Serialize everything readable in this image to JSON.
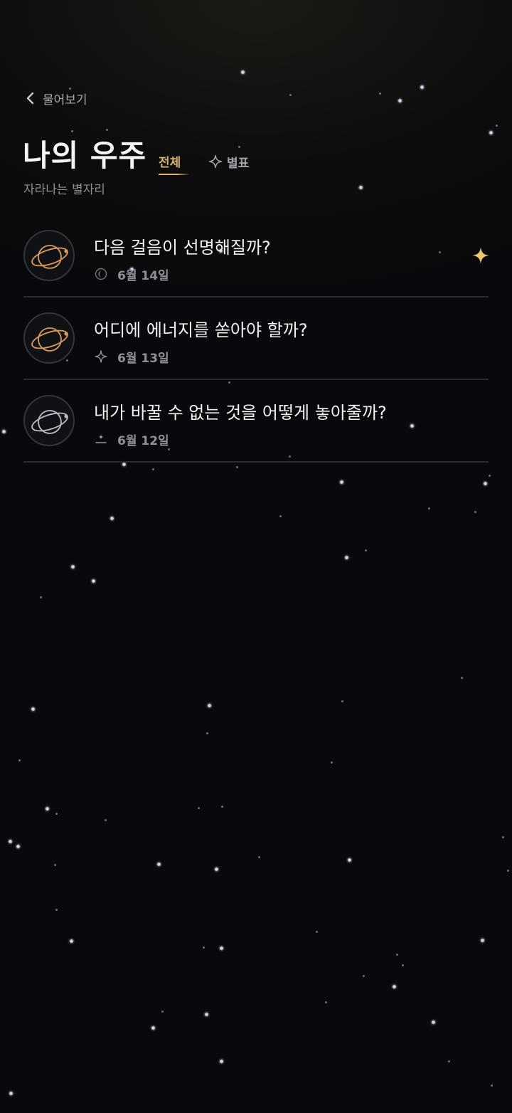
{
  "header": {
    "back_label": "물어보기",
    "title": "나의 우주",
    "subtitle": "자라나는 별자리"
  },
  "tabs": {
    "all_label": "전체",
    "starred_label": "별표",
    "active": "all"
  },
  "colors": {
    "accent": "#d8b26a",
    "orbit_gold": "#d99a5b",
    "orbit_silver": "#b9bdc7",
    "background": "#08090c"
  },
  "questions": [
    {
      "text": "다음 걸음이 선명해질까?",
      "date": "6월 14일",
      "icon": "moon-icon",
      "orbit": "gold",
      "starred": true
    },
    {
      "text": "어디에 에너지를 쏟아야 할까?",
      "date": "6월 13일",
      "icon": "sparkle-icon",
      "orbit": "gold",
      "starred": false
    },
    {
      "text": "내가 바꿀 수 없는 것을 어떻게 놓아줄까?",
      "date": "6월 12일",
      "icon": "sunrise-icon",
      "orbit": "silver",
      "starred": false
    }
  ]
}
